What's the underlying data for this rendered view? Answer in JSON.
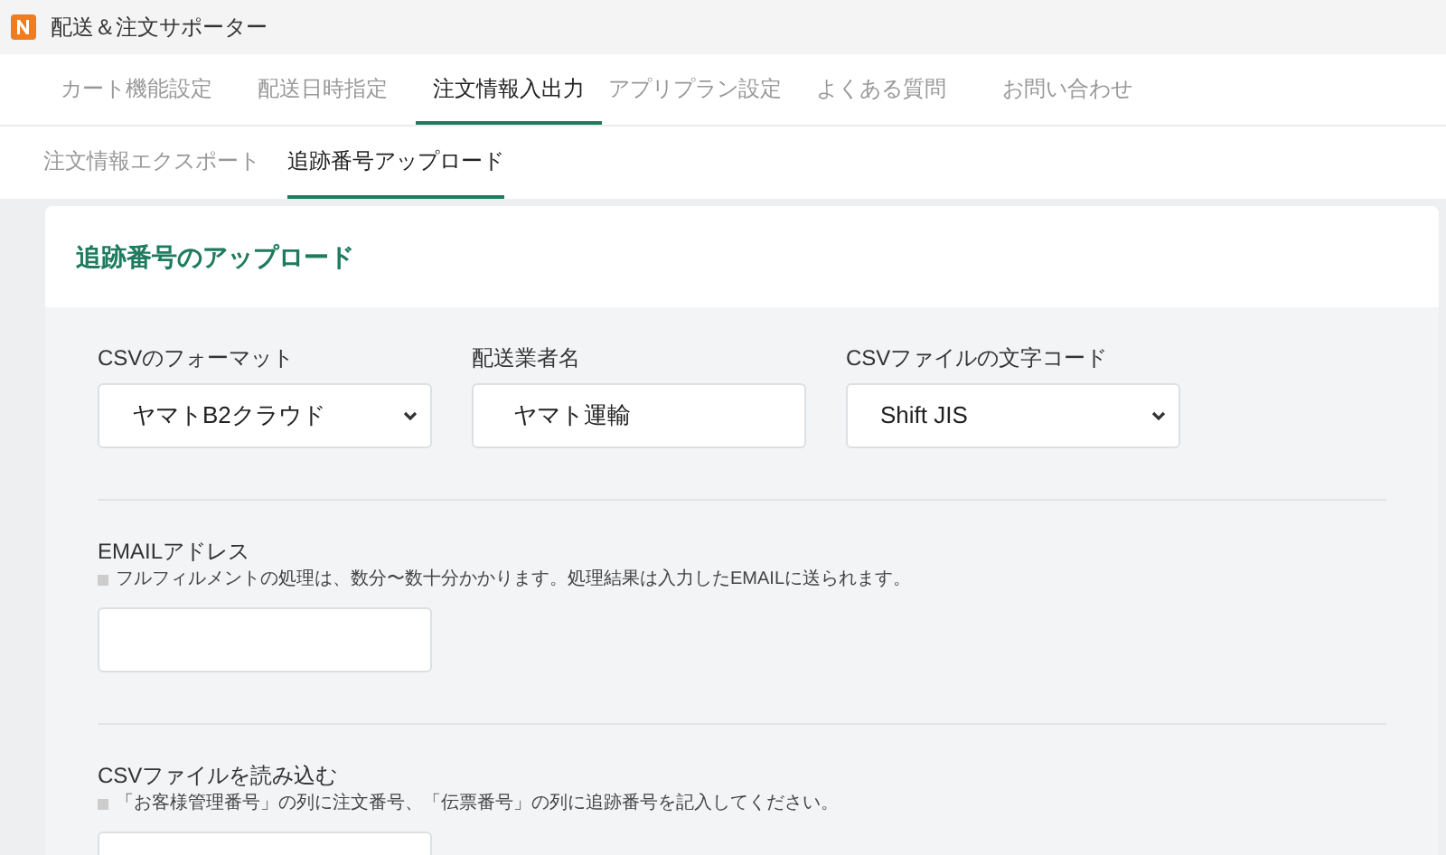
{
  "app": {
    "title": "配送＆注文サポーター"
  },
  "tabs": [
    {
      "label": "カート機能設定",
      "selected": false
    },
    {
      "label": "配送日時指定",
      "selected": false
    },
    {
      "label": "注文情報入出力",
      "selected": true
    },
    {
      "label": "アプリプラン設定",
      "selected": false
    },
    {
      "label": "よくある質問",
      "selected": false
    },
    {
      "label": "お問い合わせ",
      "selected": false
    }
  ],
  "subtabs": [
    {
      "label": "注文情報エクスポート",
      "selected": false
    },
    {
      "label": "追跡番号アップロード",
      "selected": true
    }
  ],
  "card": {
    "title": "追跡番号のアップロード",
    "sections": [
      {
        "fields": [
          {
            "kind": "select",
            "label": "CSVのフォーマット",
            "value": "ヤマトB2クラウド"
          },
          {
            "kind": "text",
            "label": "配送業者名",
            "value": "ヤマト運輸"
          },
          {
            "kind": "select",
            "label": "CSVファイルの文字コード",
            "value": "Shift JIS"
          }
        ]
      },
      {
        "label": "EMAILアドレス",
        "help": "フルフィルメントの処理は、数分〜数十分かかります。処理結果は入力したEMAILに送られます。",
        "fields": [
          {
            "kind": "text"
          }
        ]
      },
      {
        "label": "CSVファイルを読み込む",
        "help": "「お客様管理番号」の列に注文番号、「伝票番号」の列に追跡番号を記入してください。",
        "fields": [
          {
            "kind": "file"
          }
        ]
      }
    ]
  }
}
